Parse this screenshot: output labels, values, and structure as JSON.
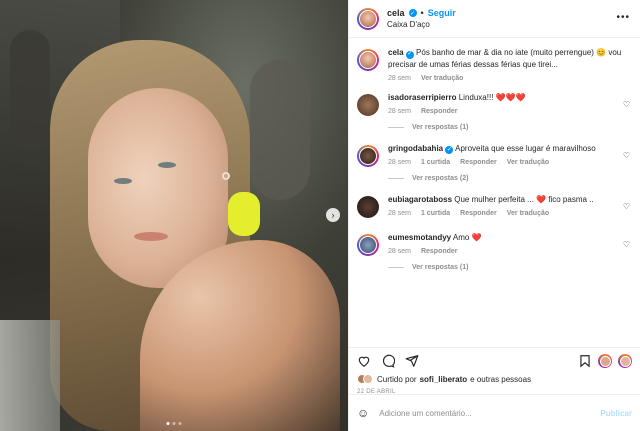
{
  "post": {
    "author": "cela",
    "follow_label": "Seguir",
    "location": "Caixa D'aço",
    "more": "•••",
    "caption_author": "cela",
    "caption": "Pós banho de mar & dia no iate (muito perrengue) 😊 vou precisar de umas férias dessas férias que tirei...",
    "caption_time": "28 sem",
    "caption_translate": "Ver tradução",
    "slide_count": 3,
    "active_slide": 1
  },
  "comments": [
    {
      "user": "isadoraserripierro",
      "text": "Linduxa!!! ❤️❤️❤️",
      "time": "28 sem",
      "likes": "",
      "reply": "Responder",
      "translate": "",
      "replies": "Ver respostas (1)",
      "verified": false
    },
    {
      "user": "gringodabahia",
      "text": "Aproveita que esse lugar é maravilhoso",
      "time": "28 sem",
      "likes": "1 curtida",
      "reply": "Responder",
      "translate": "Ver tradução",
      "replies": "Ver respostas (2)",
      "verified": true
    },
    {
      "user": "eubiagarotaboss",
      "text": "Que mulher perfeita ... ❤️ fico pasma ..",
      "time": "28 sem",
      "likes": "1 curtida",
      "reply": "Responder",
      "translate": "Ver tradução",
      "replies": "",
      "verified": false
    },
    {
      "user": "eumesmotandyy",
      "text": "Amo ❤️",
      "time": "28 sem",
      "likes": "",
      "reply": "Responder",
      "translate": "",
      "replies": "Ver respostas (1)",
      "verified": false
    }
  ],
  "liked": {
    "prefix": "Curtido por",
    "user": "sofi_liberato",
    "suffix": "e outras pessoas"
  },
  "date": "22 DE ABRIL",
  "add_comment": {
    "placeholder": "Adicione um comentário...",
    "post_label": "Publicar"
  },
  "icons": {
    "heart": "heart-icon",
    "comment": "comment-icon",
    "share": "share-icon",
    "save": "bookmark-icon",
    "emoji": "emoji-icon"
  },
  "colors": {
    "accent": "#0095f6",
    "muted": "#8e8e8e",
    "text": "#262626",
    "post_disabled": "#b2dffc",
    "heart_red": "#ed4956"
  }
}
